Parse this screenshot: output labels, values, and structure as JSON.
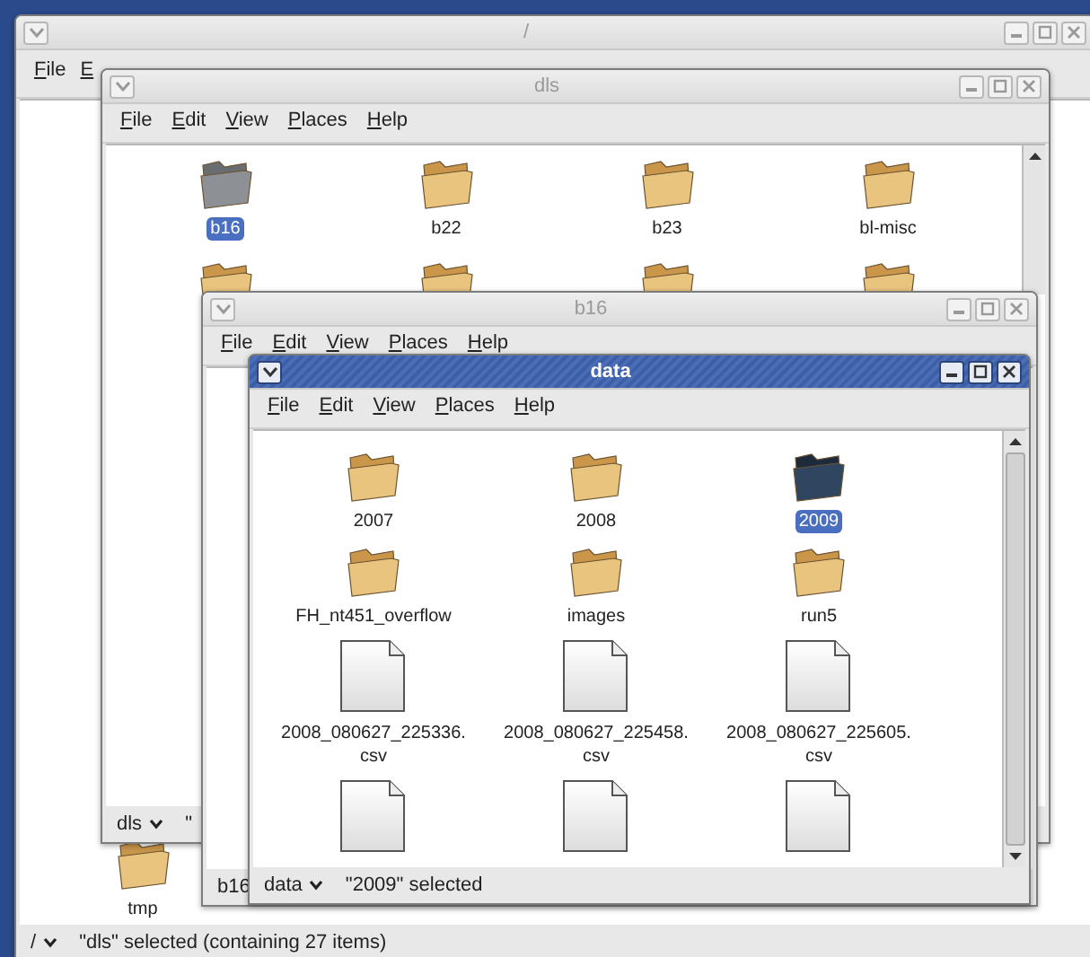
{
  "windows": [
    {
      "title": "/",
      "active": false,
      "scrollbar": false,
      "menu": [
        "File",
        "E"
      ],
      "items": [
        {
          "kind": "folder",
          "label": "tmp",
          "selected": false
        }
      ],
      "status": {
        "location": "/",
        "text": "\"dls\" selected (containing 27 items)"
      }
    },
    {
      "title": "dls",
      "active": false,
      "scrollbar": true,
      "menu": [
        "File",
        "Edit",
        "View",
        "Places",
        "Help"
      ],
      "items": [
        {
          "kind": "folder",
          "label": "b16",
          "selected": true
        },
        {
          "kind": "folder",
          "label": "b22",
          "selected": false
        },
        {
          "kind": "folder",
          "label": "b23",
          "selected": false
        },
        {
          "kind": "folder",
          "label": "bl-misc",
          "selected": false
        },
        {
          "kind": "folder"
        },
        {
          "kind": "folder"
        },
        {
          "kind": "folder"
        },
        {
          "kind": "folder"
        }
      ],
      "status": {
        "location": "dls",
        "text": "\""
      }
    },
    {
      "title": "b16",
      "active": false,
      "scrollbar": false,
      "menu": [
        "File",
        "Edit",
        "View",
        "Places",
        "Help"
      ],
      "status": {
        "location": "b16"
      }
    },
    {
      "title": "data",
      "active": true,
      "scrollbar": true,
      "menu": [
        "File",
        "Edit",
        "View",
        "Places",
        "Help"
      ],
      "items": [
        {
          "kind": "folder",
          "label": "2007",
          "selected": false
        },
        {
          "kind": "folder",
          "label": "2008",
          "selected": false
        },
        {
          "kind": "folder",
          "label": "2009",
          "selected": true
        },
        {
          "kind": "folder",
          "label": "FH_nt451_overflow",
          "selected": false
        },
        {
          "kind": "folder",
          "label": "images",
          "selected": false
        },
        {
          "kind": "folder",
          "label": "run5",
          "selected": false
        },
        {
          "kind": "document",
          "label": "2008_080627_225336.\ncsv",
          "selected": false
        },
        {
          "kind": "document",
          "label": "2008_080627_225458.\ncsv",
          "selected": false
        },
        {
          "kind": "document",
          "label": "2008_080627_225605.\ncsv",
          "selected": false
        },
        {
          "kind": "document"
        },
        {
          "kind": "document"
        },
        {
          "kind": "document"
        }
      ],
      "status": {
        "location": "data",
        "text": "\"2009\" selected"
      }
    }
  ]
}
